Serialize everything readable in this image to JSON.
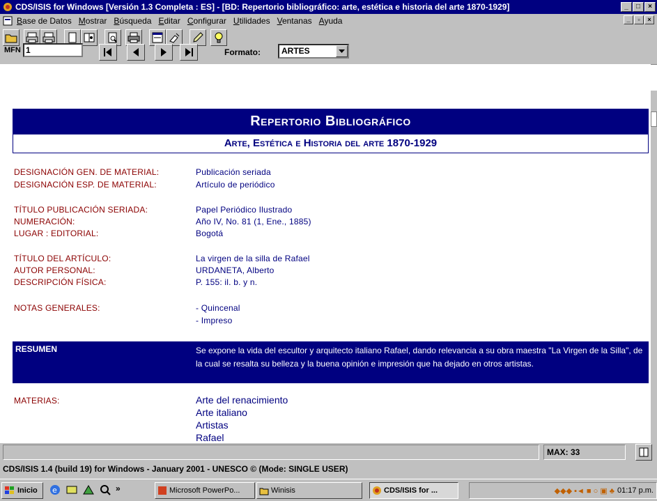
{
  "window": {
    "title": "CDS/ISIS for Windows [Versión 1.3 Completa : ES] - [BD: Repertorio bibliográfico: arte, estética e historia del arte 1870-1929]"
  },
  "menu": [
    "Base de Datos",
    "Mostrar",
    "Búsqueda",
    "Editar",
    "Configurar",
    "Utilidades",
    "Ventanas",
    "Ayuda"
  ],
  "nav": {
    "mfn_label": "MFN",
    "mfn_value": "1",
    "format_label": "Formato:",
    "format_value": "ARTES"
  },
  "record": {
    "banner_title": "Repertorio Bibliográfico",
    "banner_subtitle": "Arte, Estética e Historia del arte 1870-1929",
    "fields": [
      {
        "label": "DESIGNACIÓN GEN. DE MATERIAL:",
        "value": "Publicación seriada"
      },
      {
        "label": "DESIGNACIÓN ESP. DE MATERIAL:",
        "value": "Artículo de periódico"
      },
      {
        "label": "TÍTULO PUBLICACIÓN SERIADA:",
        "value": "Papel Periódico Ilustrado"
      },
      {
        "label": "NUMERACIÓN:",
        "value": "Año IV, No. 81 (1, Ene., 1885)"
      },
      {
        "label": "LUGAR : EDITORIAL:",
        "value": "Bogotá"
      },
      {
        "label": "TÍTULO DEL ARTÍCULO:",
        "value": "La virgen de la silla de Rafael"
      },
      {
        "label": "AUTOR PERSONAL:",
        "value": "URDANETA, Alberto"
      },
      {
        "label": "DESCRIPCIÓN FÍSICA:",
        "value": "P. 155: il. b. y n."
      },
      {
        "label": "NOTAS GENERALES:",
        "value": "- Quincenal"
      },
      {
        "label": "",
        "value": "- Impreso"
      }
    ],
    "resumen_label": "RESUMEN",
    "resumen_text": "Se expone la vida del escultor y arquitecto italiano Rafael, dando relevancia a su obra maestra \"La Virgen de la Silla\", de la cual se resalta su belleza y la buena opinión e impresión que ha dejado en otros artistas.",
    "materias_label": "MATERIAS:",
    "materias": [
      "Arte del renacimiento",
      "Arte  italiano",
      "Artistas",
      "Rafael"
    ]
  },
  "status": {
    "max_label": "MAX: 33",
    "credits": "CDS/ISIS 1.4 (build 19) for Windows - January 2001 - UNESCO © (Mode: SINGLE USER)"
  },
  "taskbar": {
    "start": "Inicio",
    "tasks": [
      "Microsoft PowerPo...",
      "Winisis",
      "CDS/ISIS for ..."
    ],
    "clock": "01:17 p.m."
  }
}
